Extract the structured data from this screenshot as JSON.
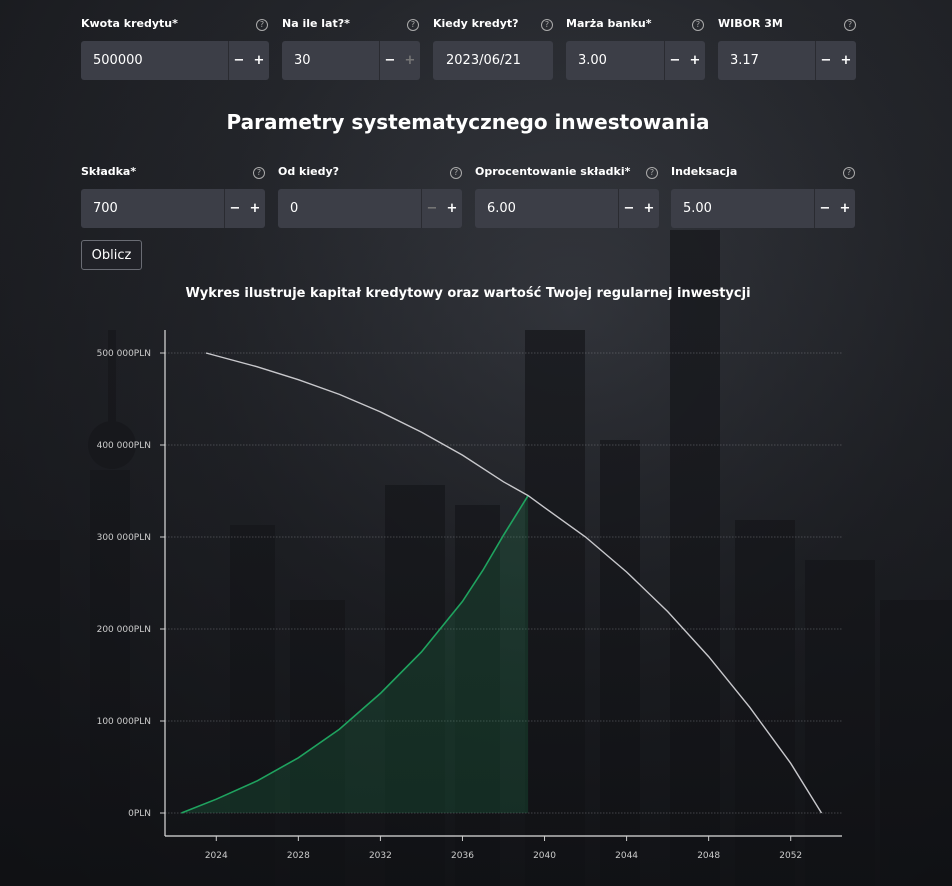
{
  "loan_fields": [
    {
      "label": "Kwota kredytu*",
      "value": "500000",
      "minus": "−",
      "plus": "+"
    },
    {
      "label": "Na ile lat?*",
      "value": "30",
      "minus": "−",
      "plus": "+"
    },
    {
      "label": "Kiedy kredyt?",
      "value": "2023/06/21"
    },
    {
      "label": "Marża banku*",
      "value": "3.00",
      "minus": "−",
      "plus": "+"
    },
    {
      "label": "WIBOR 3M",
      "value": "3.17",
      "minus": "−",
      "plus": "+"
    }
  ],
  "section_title": "Parametry systematycznego inwestowania",
  "invest_fields": [
    {
      "label": "Składka*",
      "value": "700",
      "minus": "−",
      "plus": "+"
    },
    {
      "label": "Od kiedy?",
      "value": "0",
      "minus": "−",
      "plus": "+"
    },
    {
      "label": "Oprocentowanie składki*",
      "value": "6.00",
      "minus": "−",
      "plus": "+"
    },
    {
      "label": "Indeksacja",
      "value": "5.00",
      "minus": "−",
      "plus": "+"
    }
  ],
  "help_glyph": "?",
  "calculate_label": "Oblicz",
  "chart_title": "Wykres ilustruje kapitał kredytowy oraz wartość Twojej regularnej inwestycji",
  "colors": {
    "loan_line": "#c8c8cc",
    "investment_line": "#1fa35f",
    "investment_fill": "#1fa35f"
  },
  "chart_data": {
    "type": "line",
    "title": "Wykres ilustruje kapitał kredytowy oraz wartość Twojej regularnej inwestycji",
    "xlim": [
      2021.5,
      2054.5
    ],
    "ylim": [
      -25000,
      525000
    ],
    "x_ticks": [
      "2024",
      "2028",
      "2032",
      "2036",
      "2040",
      "2044",
      "2048",
      "2052"
    ],
    "x_tick_values": [
      2024,
      2028,
      2032,
      2036,
      2040,
      2044,
      2048,
      2052
    ],
    "y_ticks": [
      "0PLN",
      "100 000PLN",
      "200 000PLN",
      "300 000PLN",
      "400 000PLN",
      "500 000PLN"
    ],
    "y_tick_values": [
      0,
      100000,
      200000,
      300000,
      400000,
      500000
    ],
    "grid": true,
    "series": [
      {
        "x": [
          2023.5,
          2026,
          2028,
          2030,
          2032,
          2034,
          2036,
          2038,
          2039.2,
          2040,
          2042,
          2044,
          2046,
          2048,
          2050,
          2052,
          2053.5
        ],
        "values": [
          500000,
          485000,
          471000,
          455000,
          436000,
          414000,
          389000,
          360000,
          345000,
          332000,
          300000,
          262000,
          219000,
          170000,
          115000,
          54000,
          0
        ]
      },
      {
        "x": [
          2022.3,
          2024,
          2026,
          2028,
          2030,
          2032,
          2034,
          2036,
          2037,
          2038,
          2039.2
        ],
        "values": [
          0,
          15000,
          35000,
          60000,
          91000,
          130000,
          175000,
          230000,
          264000,
          302000,
          345000
        ],
        "filled": true
      }
    ]
  }
}
